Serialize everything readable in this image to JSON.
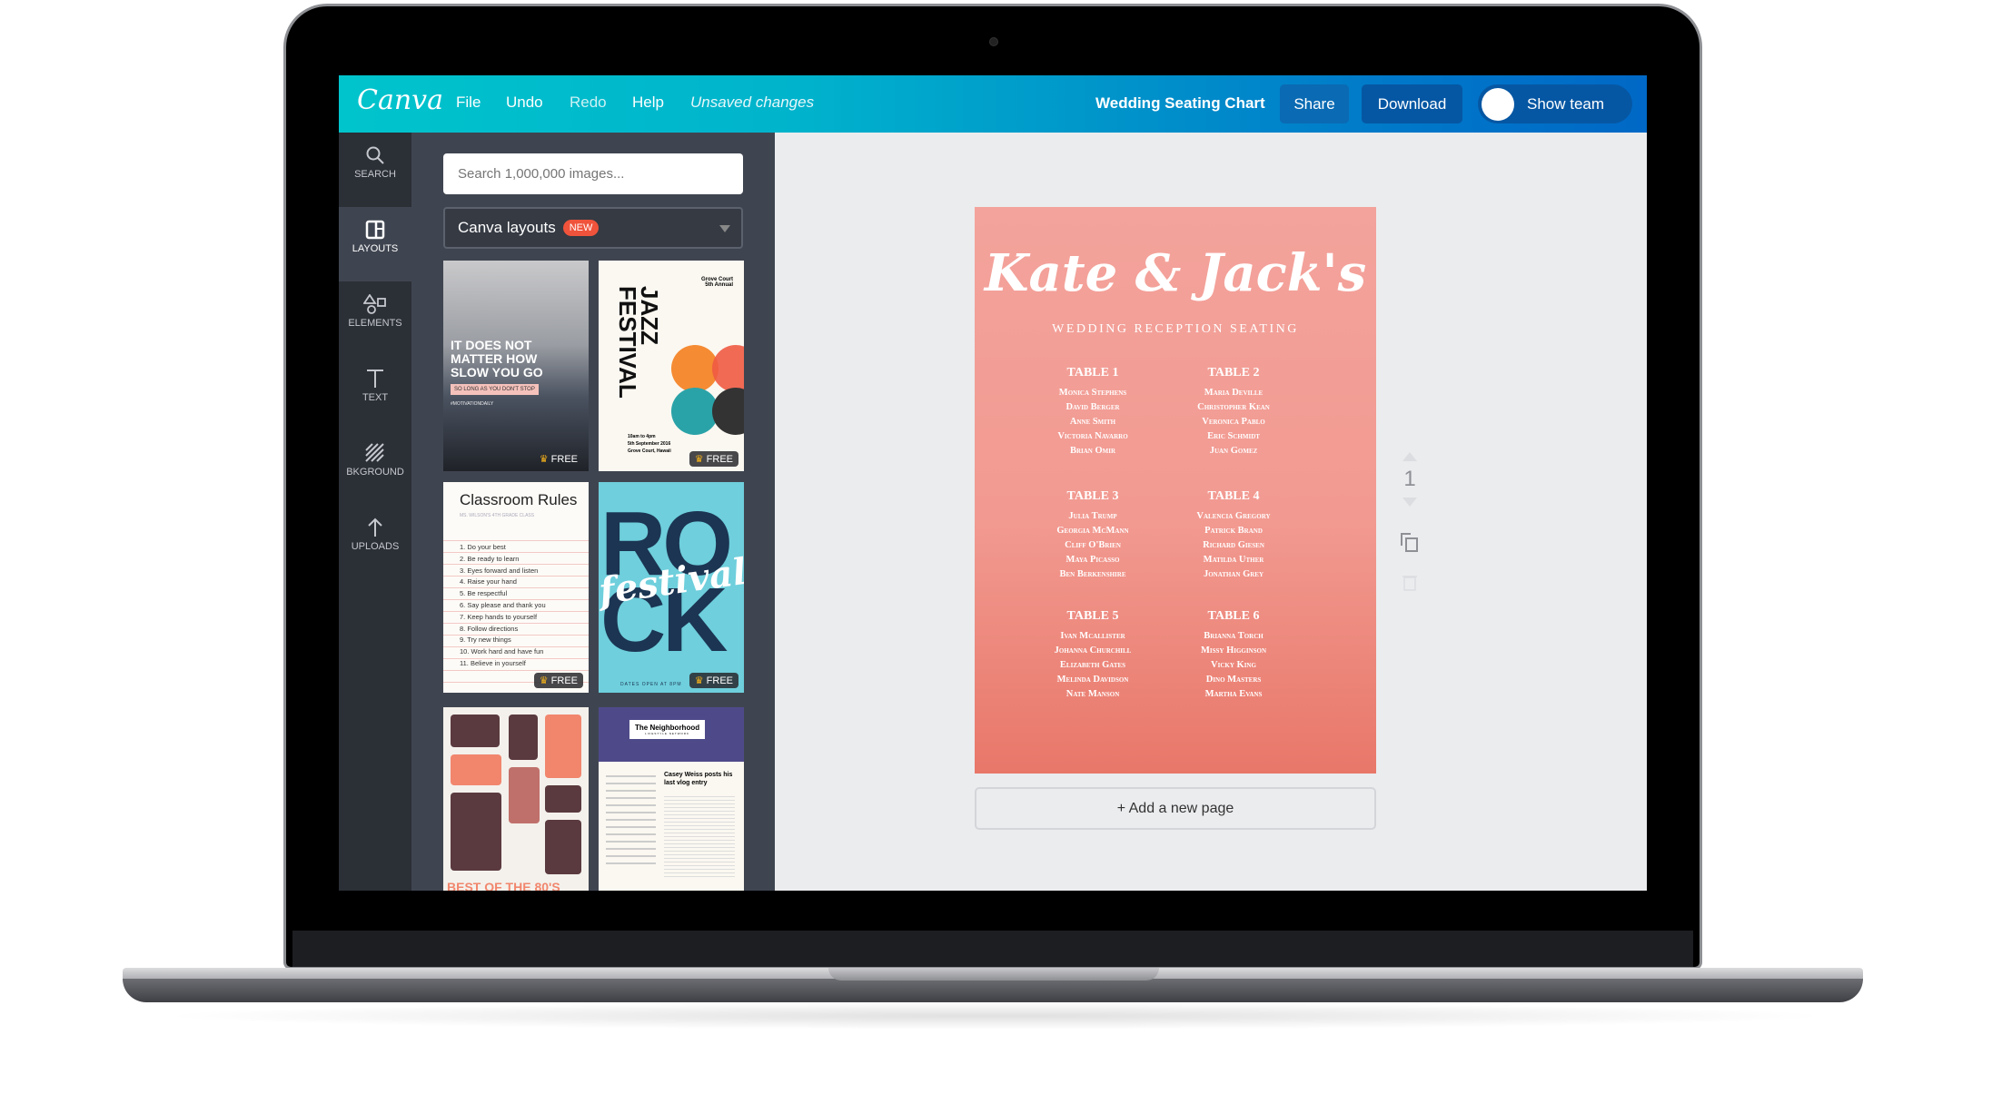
{
  "header": {
    "logo": "Canva",
    "menu": [
      "File",
      "Undo",
      "Redo",
      "Help"
    ],
    "status": "Unsaved changes",
    "doc_title": "Wedding Seating Chart",
    "share": "Share",
    "download": "Download",
    "show_team": "Show team",
    "colors": {
      "gradient_start": "#00c4cc",
      "gradient_end": "#0068c6"
    }
  },
  "sidebar": {
    "items": [
      {
        "label": "SEARCH",
        "icon": "search-icon"
      },
      {
        "label": "LAYOUTS",
        "icon": "layouts-icon"
      },
      {
        "label": "ELEMENTS",
        "icon": "shapes-icon"
      },
      {
        "label": "TEXT",
        "icon": "text-icon"
      },
      {
        "label": "BKGROUND",
        "icon": "background-icon"
      },
      {
        "label": "UPLOADS",
        "icon": "upload-arrow-icon"
      }
    ],
    "active": "LAYOUTS"
  },
  "panel": {
    "search_placeholder": "Search 1,000,000 images...",
    "dropdown_value": "Canva layouts",
    "badge": "NEW",
    "thumbnails": [
      {
        "lines": [
          "IT DOES NOT MATTER HOW SLOW YOU GO",
          "SO LONG AS YOU DON'T STOP",
          "#MOTIVATIONDAILY"
        ],
        "free": "FREE"
      },
      {
        "lines": [
          "JAZZ FESTIVAL",
          "Grove Court 5th Annual",
          "10am to 4pm",
          "5th September 2016",
          "Grove Court, Hawaii"
        ],
        "free": "FREE"
      },
      {
        "lines": [
          "Classroom Rules",
          "MS. WILSON'S 4TH GRADE CLASS",
          "1. Do your best",
          "2. Be ready to learn",
          "3. Eyes forward and listen",
          "4. Raise your hand",
          "5. Be respectful",
          "6. Say please and thank you",
          "7. Keep hands to yourself",
          "8. Follow directions",
          "9. Try new things",
          "10. Work hard and have fun",
          "11. Believe in yourself"
        ],
        "free": "FREE"
      },
      {
        "lines": [
          "ROCK",
          "festival",
          "DATES OPEN AT 8PM"
        ],
        "free": "FREE"
      },
      {
        "lines": [
          "BEST OF THE 80'S"
        ]
      },
      {
        "lines": [
          "The Neighborhood",
          "LIFESTYLE NETWORK",
          "Casey Weiss posts his last vlog entry"
        ]
      }
    ],
    "free_label": "FREE"
  },
  "design": {
    "title": "Kate & Jack's",
    "subtitle": "WEDDING RECEPTION SEATING",
    "bg_color": "#f29a91",
    "tables": [
      {
        "name": "TABLE 1",
        "guests": [
          "Monica Stephens",
          "David Berger",
          "Anne Smith",
          "Victoria Navarro",
          "Brian Omir"
        ]
      },
      {
        "name": "TABLE 2",
        "guests": [
          "Maria Deville",
          "Christopher Kean",
          "Veronica Pablo",
          "Eric Schmidt",
          "Juan Gomez"
        ]
      },
      {
        "name": "TABLE 3",
        "guests": [
          "Julia Trump",
          "Georgia McMann",
          "Cliff O'Brien",
          "Maya Picasso",
          "Ben Berkenshire"
        ]
      },
      {
        "name": "TABLE 4",
        "guests": [
          "Valencia Gregory",
          "Patrick Brand",
          "Richard Giesen",
          "Matilda Uther",
          "Jonathan Grey"
        ]
      },
      {
        "name": "TABLE 5",
        "guests": [
          "Ivan Mcallister",
          "Johanna Churchill",
          "Elizabeth Gates",
          "Melinda Davidson",
          "Nate Manson"
        ]
      },
      {
        "name": "TABLE 6",
        "guests": [
          "Brianna Torch",
          "Missy Higginson",
          "Vicky King",
          "Dino Masters",
          "Martha Evans"
        ]
      }
    ]
  },
  "canvas": {
    "add_page": "+ Add a new page",
    "page_number": "1"
  }
}
